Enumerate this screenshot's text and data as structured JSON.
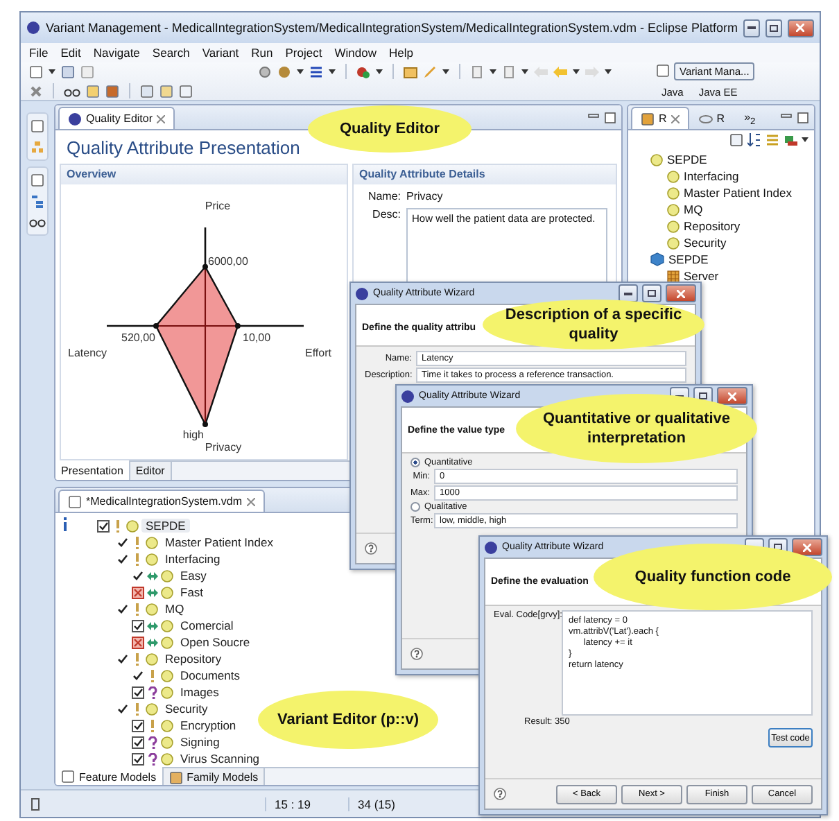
{
  "window": {
    "title": "Variant Management - MedicalIntegrationSystem/MedicalIntegrationSystem/MedicalIntegrationSystem.vdm - Eclipse Platform"
  },
  "menu": [
    "File",
    "Edit",
    "Navigate",
    "Search",
    "Variant",
    "Run",
    "Project",
    "Window",
    "Help"
  ],
  "perspectives": [
    {
      "label": "Variant Mana...",
      "selected": true
    },
    {
      "label": "Java",
      "selected": false
    },
    {
      "label": "Java EE",
      "selected": false
    }
  ],
  "quality_editor": {
    "tab": "Quality Editor",
    "heading": "Quality Attribute Presentation",
    "overview": {
      "title": "Overview",
      "axes": [
        {
          "name": "Price",
          "value": "6000,00"
        },
        {
          "name": "Effort",
          "value": "10,00"
        },
        {
          "name": "Privacy",
          "value": "high"
        },
        {
          "name": "Latency",
          "value": "520,00"
        }
      ]
    },
    "details": {
      "title": "Quality Attribute Details",
      "name_label": "Name:",
      "name": "Privacy",
      "desc_label": "Desc:",
      "desc": "How well the patient data are protected."
    },
    "tabs": [
      {
        "label": "Presentation",
        "selected": true
      },
      {
        "label": "Editor",
        "selected": false
      }
    ]
  },
  "outline": {
    "tabs": [
      {
        "label": "R",
        "selected": true
      },
      {
        "label": "R",
        "selected": false
      }
    ],
    "overflow": "»$_{2}$",
    "tree": [
      {
        "label": "SEPDE",
        "kind": "feature",
        "children": [
          {
            "label": "Interfacing",
            "kind": "feature"
          },
          {
            "label": "Master Patient Index",
            "kind": "feature"
          },
          {
            "label": "MQ",
            "kind": "feature"
          },
          {
            "label": "Repository",
            "kind": "feature"
          },
          {
            "label": "Security",
            "kind": "feature"
          }
        ]
      },
      {
        "label": "SEPDE",
        "kind": "family",
        "children": [
          {
            "label": "Server",
            "kind": "component"
          }
        ]
      }
    ]
  },
  "variant_editor": {
    "tab": "*MedicalIntegrationSystem.vdm",
    "tree": [
      {
        "label": "SEPDE",
        "checked": true,
        "excluded": false,
        "kind": "mandatory",
        "selected": true,
        "children": [
          {
            "label": "Master Patient Index",
            "checked": false,
            "excluded": false,
            "kind": "mandatory",
            "selected": false
          },
          {
            "label": "Interfacing",
            "checked": false,
            "excluded": false,
            "kind": "mandatory",
            "selected": false,
            "children": [
              {
                "label": "Easy",
                "checked": false,
                "excluded": false,
                "kind": "alternative",
                "selected": false
              },
              {
                "label": "Fast",
                "checked": false,
                "excluded": true,
                "kind": "alternative",
                "selected": false
              }
            ]
          },
          {
            "label": "MQ",
            "checked": false,
            "excluded": false,
            "kind": "mandatory",
            "selected": false,
            "children": [
              {
                "label": "Comercial",
                "checked": true,
                "excluded": false,
                "kind": "alternative",
                "selected": false
              },
              {
                "label": "Open Soucre",
                "checked": false,
                "excluded": true,
                "kind": "alternative",
                "selected": false
              }
            ]
          },
          {
            "label": "Repository",
            "checked": false,
            "excluded": false,
            "kind": "mandatory",
            "selected": false,
            "children": [
              {
                "label": "Documents",
                "checked": false,
                "excluded": false,
                "kind": "mandatory",
                "selected": false
              },
              {
                "label": "Images",
                "checked": true,
                "excluded": false,
                "kind": "optional",
                "selected": false
              }
            ]
          },
          {
            "label": "Security",
            "checked": false,
            "excluded": false,
            "kind": "mandatory",
            "selected": false,
            "children": [
              {
                "label": "Encryption",
                "checked": true,
                "excluded": false,
                "kind": "mandatory",
                "selected": false
              },
              {
                "label": "Signing",
                "checked": true,
                "excluded": false,
                "kind": "optional",
                "selected": false
              },
              {
                "label": "Virus Scanning",
                "checked": true,
                "excluded": false,
                "kind": "optional",
                "selected": false
              }
            ]
          }
        ]
      }
    ],
    "tabs": [
      {
        "label": "Feature Models",
        "selected": true
      },
      {
        "label": "Family Models",
        "selected": false
      }
    ]
  },
  "status_bar": [
    "15 : 19",
    "34 (15)"
  ],
  "wizard_attribute": {
    "title": "Quality Attribute Wizard",
    "header": "Define the quality attribu",
    "fields": [
      {
        "label": "Name:",
        "value": "Latency"
      },
      {
        "label": "Description:",
        "value": "Time it takes to process a reference transaction."
      }
    ]
  },
  "wizard_value_type": {
    "title": "Quality Attribute Wizard",
    "header": "Define the value type",
    "options": [
      {
        "label": "Quantitative",
        "selected": true,
        "fields": [
          {
            "label": "Min:",
            "value": "0"
          },
          {
            "label": "Max:",
            "value": "1000"
          }
        ]
      },
      {
        "label": "Qualitative",
        "selected": false,
        "fields": [
          {
            "label": "Term:",
            "value": "low, middle, high"
          }
        ]
      }
    ]
  },
  "wizard_evaluation": {
    "title": "Quality Attribute Wizard",
    "header": "Define the evaluation",
    "code_label": "Eval. Code[grvy]:",
    "code": [
      "def latency = 0",
      "vm.attribV('Lat').each {",
      "      latency += it",
      "}",
      "return latency"
    ],
    "result": "Result: 350",
    "test_button": "Test code",
    "buttons": [
      "< Back",
      "Next >",
      "Finish",
      "Cancel"
    ]
  },
  "callouts": [
    "Quality Editor",
    "Description of a specific quality",
    "Quantitative or qualitative interpretation",
    "Quality function code",
    "Variant Editor (p::v)"
  ]
}
